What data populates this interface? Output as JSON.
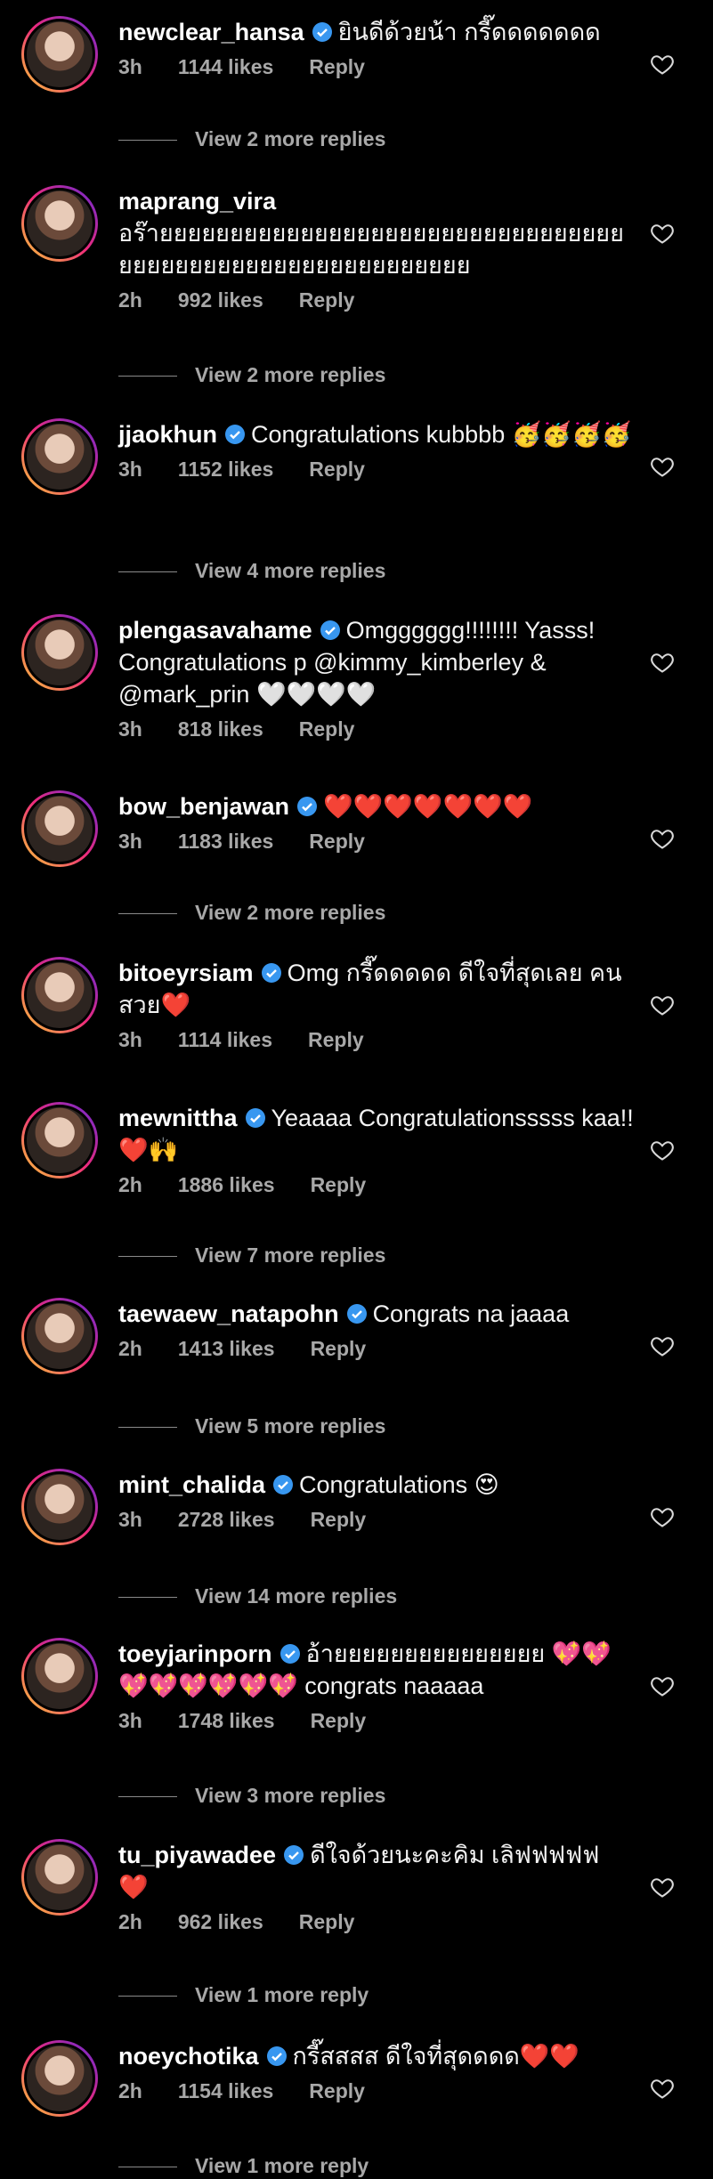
{
  "comments": [
    {
      "username": "newclear_hansa",
      "verified": true,
      "text": "ยินดีด้วยน้า กรี๊ดดดดดดด",
      "time": "3h",
      "likes": "1144 likes",
      "reply": "Reply",
      "more": "View 2 more replies"
    },
    {
      "username": "maprang_vira",
      "verified": false,
      "text": "อร๊ายยยยยยยยยยยยยยยยยยยยยยยยยยยยยยยยยยยยยยยยยยยยยยยยยยยยยยยยยย",
      "time": "2h",
      "likes": "992 likes",
      "reply": "Reply",
      "more": "View 2 more replies"
    },
    {
      "username": "jjaokhun",
      "verified": true,
      "text": "Congratulations kubbbb 🥳🥳🥳🥳",
      "time": "3h",
      "likes": "1152 likes",
      "reply": "Reply",
      "more": "View 4 more replies"
    },
    {
      "username": "plengasavahame",
      "verified": true,
      "text": "Omgggggg!!!!!!!! Yasss! Congratulations p @kimmy_kimberley & @mark_prin 🤍🤍🤍🤍",
      "time": "3h",
      "likes": "818 likes",
      "reply": "Reply",
      "more": ""
    },
    {
      "username": "bow_benjawan",
      "verified": true,
      "text": "❤️❤️❤️❤️❤️❤️❤️",
      "time": "3h",
      "likes": "1183 likes",
      "reply": "Reply",
      "more": "View 2 more replies"
    },
    {
      "username": "bitoeyrsiam",
      "verified": true,
      "text": "Omg กรี๊ดดดดด ดีใจที่สุดเลย คนสวย❤️",
      "time": "3h",
      "likes": "1114 likes",
      "reply": "Reply",
      "more": ""
    },
    {
      "username": "mewnittha",
      "verified": true,
      "text": "Yeaaaa Congratulationsssss kaa!!❤️🙌",
      "time": "2h",
      "likes": "1886 likes",
      "reply": "Reply",
      "more": "View 7 more replies"
    },
    {
      "username": "taewaew_natapohn",
      "verified": true,
      "text": "Congrats na jaaaa",
      "time": "2h",
      "likes": "1413 likes",
      "reply": "Reply",
      "more": "View 5 more replies"
    },
    {
      "username": "mint_chalida",
      "verified": true,
      "text": "Congratulations 😍",
      "time": "3h",
      "likes": "2728 likes",
      "reply": "Reply",
      "more": "View 14 more replies"
    },
    {
      "username": "toeyjarinporn",
      "verified": true,
      "text": "อ้ายยยยยยยยยยยยยยย 💖💖💖💖💖💖💖💖 congrats naaaaa",
      "time": "3h",
      "likes": "1748 likes",
      "reply": "Reply",
      "more": "View 3 more replies"
    },
    {
      "username": "tu_piyawadee",
      "verified": true,
      "text": "ดีใจด้วยนะคะคิม เลิฟฟฟฟฟ ❤️",
      "time": "2h",
      "likes": "962 likes",
      "reply": "Reply",
      "more": "View 1 more reply"
    },
    {
      "username": "noeychotika",
      "verified": true,
      "text": "กรี๊สสสส ดีใจที่สุดดดด❤️❤️",
      "time": "2h",
      "likes": "1154 likes",
      "reply": "Reply",
      "more": "View 1 more reply"
    }
  ]
}
